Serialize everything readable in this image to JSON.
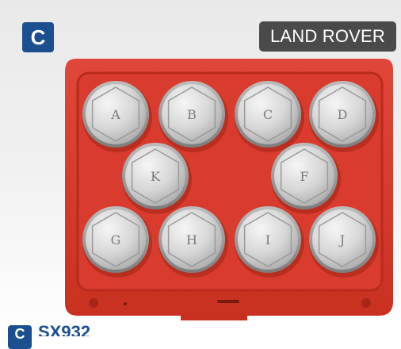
{
  "badge": {
    "letter": "C",
    "color": "#1b4f8f"
  },
  "brand": {
    "label": "LAND ROVER",
    "color": "#4a4a4a"
  },
  "case": {
    "color": "#d63a2c"
  },
  "sockets": [
    "A",
    "B",
    "C",
    "D",
    "K",
    "F",
    "G",
    "H",
    "I",
    "J"
  ],
  "footer": {
    "badge": "C",
    "text": "SX932"
  }
}
